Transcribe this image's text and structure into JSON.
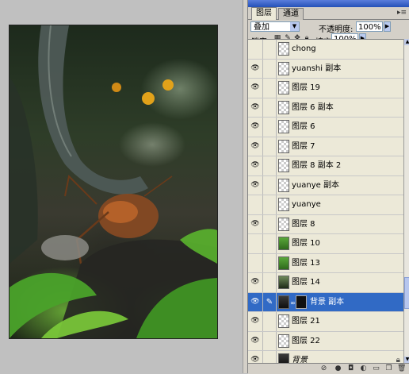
{
  "tabs": [
    "图层",
    "通道"
  ],
  "panel_menu_icon": "panel-menu-icon",
  "blend_mode": "叠加",
  "opacity_label": "不透明度:",
  "opacity_value": "100%",
  "lock_label": "锁定:",
  "fill_label": "填充:",
  "fill_value": "100%",
  "layers": [
    {
      "name": "chong",
      "visible": false,
      "thumb": "checker"
    },
    {
      "name": "yuanshi 副本",
      "visible": true,
      "thumb": "checker"
    },
    {
      "name": "图层 19",
      "visible": true,
      "thumb": "checker"
    },
    {
      "name": "图层 6 副本",
      "visible": true,
      "thumb": "checker"
    },
    {
      "name": "图层 6",
      "visible": true,
      "thumb": "checker"
    },
    {
      "name": "图层 7",
      "visible": true,
      "thumb": "checker"
    },
    {
      "name": "图层 8 副本 2",
      "visible": true,
      "thumb": "checker"
    },
    {
      "name": "yuanye 副本",
      "visible": true,
      "thumb": "checker"
    },
    {
      "name": "yuanye",
      "visible": false,
      "thumb": "checker"
    },
    {
      "name": "图层 8",
      "visible": true,
      "thumb": "checker"
    },
    {
      "name": "图层 10",
      "visible": false,
      "thumb": "green"
    },
    {
      "name": "图层 13",
      "visible": false,
      "thumb": "green"
    },
    {
      "name": "图层 14",
      "visible": true,
      "thumb": "scene"
    },
    {
      "name": "背景 副本",
      "visible": true,
      "thumb": "dark",
      "selected": true,
      "mask": true
    },
    {
      "name": "图层 21",
      "visible": true,
      "thumb": "checker"
    },
    {
      "name": "图层 22",
      "visible": true,
      "thumb": "checker"
    },
    {
      "name": "背景",
      "visible": true,
      "thumb": "dark",
      "locked": true,
      "italic": true
    }
  ],
  "colors": {
    "selected": "#316ac5",
    "panel": "#d4d0c8",
    "canvas_bg": "#c0c0c0"
  }
}
